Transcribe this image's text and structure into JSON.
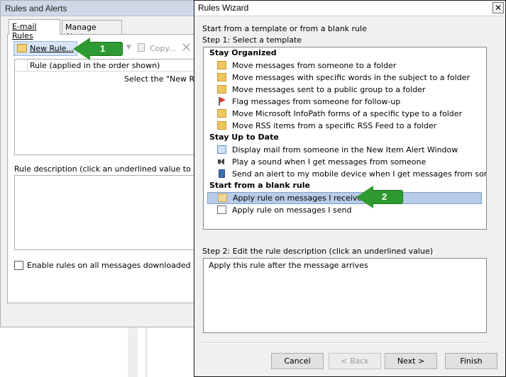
{
  "rules_and_alerts": {
    "title": "Rules and Alerts",
    "tabs": [
      "E-mail Rules",
      "Manage Alerts"
    ],
    "toolbar": {
      "new_rule": "New Rule...",
      "copy": "Copy..."
    },
    "column_header": "Rule (applied in the order shown)",
    "empty_hint": "Select the \"New Rule",
    "rule_description_label": "Rule description (click an underlined value to edit",
    "enable_rules_label": "Enable rules on all messages downloaded fro"
  },
  "rules_wizard": {
    "title": "Rules Wizard",
    "intro": "Start from a template or from a blank rule",
    "step1": "Step 1: Select a template",
    "groups": [
      {
        "name": "Stay Organized",
        "items": [
          {
            "label": "Move messages from someone to a folder",
            "icon": "folder-icon"
          },
          {
            "label": "Move messages with specific words in the subject to a folder",
            "icon": "folder-icon"
          },
          {
            "label": "Move messages sent to a public group to a folder",
            "icon": "folder-icon"
          },
          {
            "label": "Flag messages from someone for follow-up",
            "icon": "flag-icon"
          },
          {
            "label": "Move Microsoft InfoPath forms of a specific type to a folder",
            "icon": "folder-icon"
          },
          {
            "label": "Move RSS items from a specific RSS Feed to a folder",
            "icon": "folder-icon"
          }
        ]
      },
      {
        "name": "Stay Up to Date",
        "items": [
          {
            "label": "Display mail from someone in the New Item Alert Window",
            "icon": "alert-window-icon"
          },
          {
            "label": "Play a sound when I get messages from someone",
            "icon": "sound-icon"
          },
          {
            "label": "Send an alert to my mobile device when I get messages from someon",
            "icon": "mobile-icon"
          }
        ]
      },
      {
        "name": "Start from a blank rule",
        "items": [
          {
            "label": "Apply rule on messages I receive",
            "icon": "mail-icon",
            "selected": true
          },
          {
            "label": "Apply rule on messages I send",
            "icon": "send-mail-icon"
          }
        ]
      }
    ],
    "step2": "Step 2: Edit the rule description (click an underlined value)",
    "description": "Apply this rule after the message arrives",
    "buttons": {
      "cancel": "Cancel",
      "back": "< Back",
      "next": "Next >",
      "finish": "Finish"
    }
  },
  "annotations": {
    "arrow1": "1",
    "arrow2": "2"
  },
  "colors": {
    "arrow_green": "#2e9a31",
    "selection": "#b9cbe6"
  }
}
